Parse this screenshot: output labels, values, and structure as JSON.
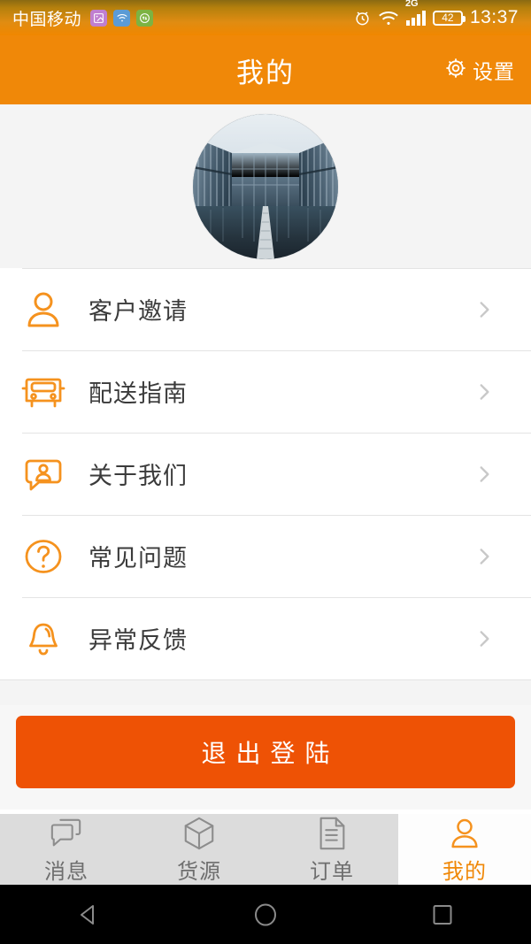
{
  "status_bar": {
    "carrier": "中国移动",
    "tray_icons": [
      "gallery-badge-icon",
      "wifi-badge-icon",
      "data-transfer-badge-icon"
    ],
    "right_icons": [
      "alarm-icon",
      "wifi-icon",
      "signal-2g-icon"
    ],
    "network_label": "2G",
    "battery_level": "42",
    "clock": "13:37"
  },
  "app_bar": {
    "title": "我的",
    "settings_label": "设置",
    "settings_icon": "gear-icon",
    "background_color": "#f08808"
  },
  "profile": {
    "avatar_icon": "avatar-photo-glass-building"
  },
  "menu": {
    "items": [
      {
        "label": "客户邀请",
        "icon": "person-icon",
        "chevron": "chevron-right-icon"
      },
      {
        "label": "配送指南",
        "icon": "truck-icon",
        "chevron": "chevron-right-icon"
      },
      {
        "label": "关于我们",
        "icon": "person-chat-bubble-icon",
        "chevron": "chevron-right-icon"
      },
      {
        "label": "常见问题",
        "icon": "question-circle-icon",
        "chevron": "chevron-right-icon"
      },
      {
        "label": "异常反馈",
        "icon": "bell-icon",
        "chevron": "chevron-right-icon"
      }
    ]
  },
  "logout": {
    "label": "退出登陆",
    "color": "#ee5205"
  },
  "tab_bar": {
    "active_index": 3,
    "accent_color": "#f08808",
    "items": [
      {
        "label": "消息",
        "icon": "chat-bubbles-icon"
      },
      {
        "label": "货源",
        "icon": "cube-box-icon"
      },
      {
        "label": "订单",
        "icon": "document-lines-icon"
      },
      {
        "label": "我的",
        "icon": "person-icon"
      }
    ]
  },
  "android_nav": {
    "items": [
      {
        "name": "back",
        "icon": "triangle-back-icon"
      },
      {
        "name": "home",
        "icon": "circle-home-icon"
      },
      {
        "name": "recents",
        "icon": "square-recents-icon"
      }
    ]
  }
}
